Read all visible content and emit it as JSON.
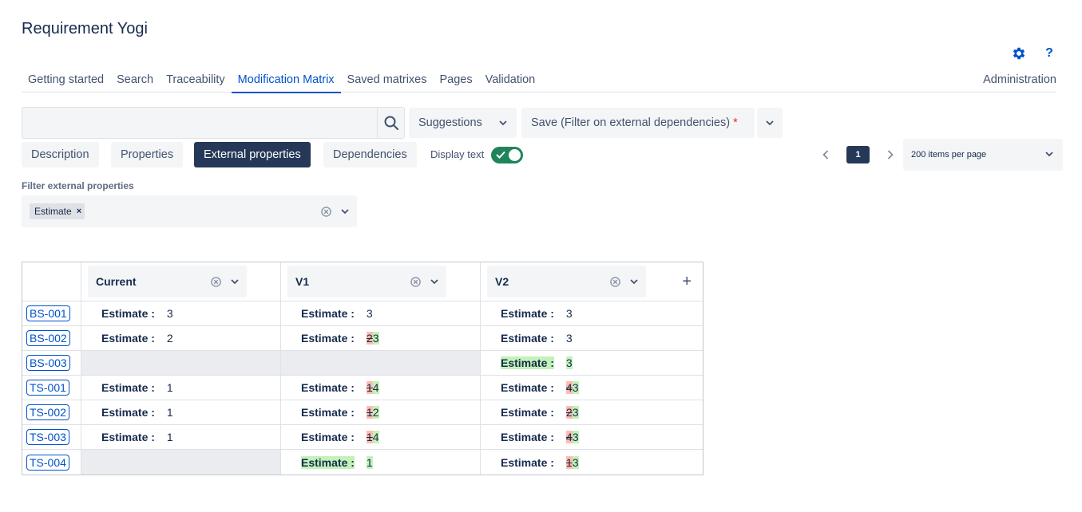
{
  "app": {
    "title": "Requirement Yogi"
  },
  "tabs": [
    {
      "label": "Getting started"
    },
    {
      "label": "Search"
    },
    {
      "label": "Traceability"
    },
    {
      "label": "Modification Matrix"
    },
    {
      "label": "Saved matrixes"
    },
    {
      "label": "Pages"
    },
    {
      "label": "Validation"
    }
  ],
  "admin_label": "Administration",
  "help_label": "?",
  "search": {
    "value": "",
    "placeholder": ""
  },
  "suggestions_label": "Suggestions",
  "save": {
    "label": "Save (Filter on external dependencies)",
    "required_mark": "*"
  },
  "subtabs": [
    {
      "label": "Description"
    },
    {
      "label": "Properties"
    },
    {
      "label": "External properties"
    },
    {
      "label": "Dependencies"
    }
  ],
  "display_text_label": "Display text",
  "pagination": {
    "current_page": "1",
    "per_page_label": "200 items per page"
  },
  "filter": {
    "label": "Filter external properties",
    "chip": "Estimate",
    "chip_remove": "×"
  },
  "matrix": {
    "columns": [
      "Current",
      "V1",
      "V2"
    ],
    "add_column": "+",
    "rows": [
      {
        "key": "BS-001",
        "cells": [
          {
            "name": "Estimate :",
            "value": "3"
          },
          {
            "name": "Estimate :",
            "value": "3"
          },
          {
            "name": "Estimate :",
            "value": "3"
          }
        ]
      },
      {
        "key": "BS-002",
        "cells": [
          {
            "name": "Estimate :",
            "value": "2"
          },
          {
            "name": "Estimate :",
            "old": "2",
            "new": "3"
          },
          {
            "name": "Estimate :",
            "value": "3"
          }
        ]
      },
      {
        "key": "BS-003",
        "cells": [
          {
            "empty": true
          },
          {
            "empty": true
          },
          {
            "name": "Estimate :",
            "value": "3",
            "added": true
          }
        ]
      },
      {
        "key": "TS-001",
        "cells": [
          {
            "name": "Estimate :",
            "value": "1"
          },
          {
            "name": "Estimate :",
            "old": "1",
            "new": "4"
          },
          {
            "name": "Estimate :",
            "old": "4",
            "new": "3"
          }
        ]
      },
      {
        "key": "TS-002",
        "cells": [
          {
            "name": "Estimate :",
            "value": "1"
          },
          {
            "name": "Estimate :",
            "old": "1",
            "new": "2"
          },
          {
            "name": "Estimate :",
            "old": "2",
            "new": "3"
          }
        ]
      },
      {
        "key": "TS-003",
        "cells": [
          {
            "name": "Estimate :",
            "value": "1"
          },
          {
            "name": "Estimate :",
            "old": "1",
            "new": "4"
          },
          {
            "name": "Estimate :",
            "old": "4",
            "new": "3"
          }
        ]
      },
      {
        "key": "TS-004",
        "cells": [
          {
            "empty": true
          },
          {
            "name": "Estimate :",
            "value": "1",
            "added": true
          },
          {
            "name": "Estimate :",
            "old": "1",
            "new": "3"
          }
        ]
      }
    ]
  },
  "colors": {
    "primary": "#0052cc",
    "dark_navy": "#253858",
    "toggle_on": "#1f845a",
    "diff_removed": "#ffbdad",
    "diff_added": "#c3f2b9",
    "empty_cell": "#ebecf0"
  },
  "icons": {
    "settings": "gear-icon",
    "help": "question-icon",
    "search": "search-icon",
    "dropdown": "chevron-down-icon",
    "clear": "clear-icon",
    "prev": "chevron-left-icon",
    "next": "chevron-right-icon",
    "add": "plus-icon"
  }
}
